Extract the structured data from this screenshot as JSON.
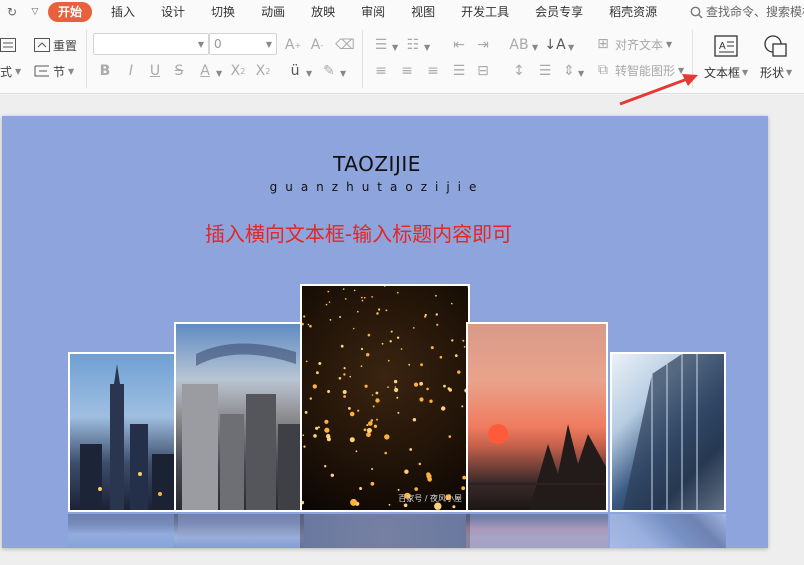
{
  "menu": {
    "tabs": [
      {
        "label": "开始",
        "active": true
      },
      {
        "label": "插入",
        "active": false
      },
      {
        "label": "设计",
        "active": false
      },
      {
        "label": "切换",
        "active": false
      },
      {
        "label": "动画",
        "active": false
      },
      {
        "label": "放映",
        "active": false
      },
      {
        "label": "审阅",
        "active": false
      },
      {
        "label": "视图",
        "active": false
      },
      {
        "label": "开发工具",
        "active": false
      },
      {
        "label": "会员专享",
        "active": false
      },
      {
        "label": "稻壳资源",
        "active": false
      }
    ],
    "search_label": "查找命令、搜索模板"
  },
  "ribbon": {
    "reset_label": "重置",
    "format_label": "式",
    "section_label": "节",
    "font_name_value": "",
    "font_size_value": "0",
    "align_text_label": "对齐文本",
    "smart_graphic_label": "转智能图形",
    "textbox_label": "文本框",
    "shape_label": "形状"
  },
  "slide": {
    "title": "TAOZIJIE",
    "subtitle": "guanzhutaozijie",
    "heading": "插入横向文本框-输入标题内容即可",
    "photo_caption": "百家号 / 夜风小屋",
    "background_color": "#8ea4dc",
    "heading_color": "#e32626"
  },
  "colors": {
    "accent_tab": "#e8603c",
    "annotation_arrow": "#e53935"
  }
}
